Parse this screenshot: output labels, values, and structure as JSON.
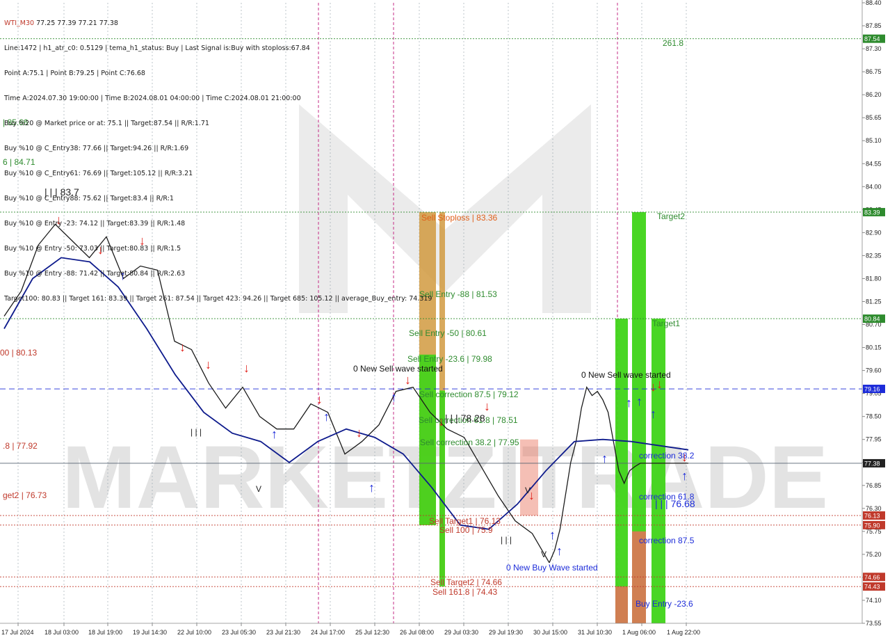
{
  "header": {
    "symbol": "WTI_M30",
    "ohlc": "77.25 77.39 77.21 77.38"
  },
  "info_lines": [
    "Line:1472 | h1_atr_c0: 0.5129 | tema_h1_status: Buy | Last Signal is:Buy with stoploss:67.84",
    "Point A:75.1 | Point B:79.25 | Point C:76.68",
    "Time A:2024.07.30 19:00:00 | Time B:2024.08.01 04:00:00 | Time C:2024.08.01 21:00:00",
    "Buy %20 @ Market price or at: 75.1 || Target:87.54 || R/R:1.71",
    "Buy %10 @ C_Entry38: 77.66 || Target:94.26 || R/R:1.69",
    "Buy %10 @ C_Entry61: 76.69 || Target:105.12 || R/R:3.21",
    "Buy %10 @ C_Entry88: 75.62 || Target:83.4 || R/R:1",
    "Buy %10 @ Entry -23: 74.12 || Target:83.39 || R/R:1.48",
    "Buy %10 @ Entry -50: 73.03 || Target:80.83 || R/R:1.5",
    "Buy %10 @ Entry -88: 71.42 || Target:80.84 || R/R:2.63",
    "Target100: 80.83 || Target 161: 83.39 || Target 261: 87.54 || Target 423: 94.26 || Target 685: 105.12 || average_Buy_entry: 74.319"
  ],
  "watermark": "MARKETZITRADE",
  "chart_data": {
    "type": "line",
    "title": "",
    "xlabel": "",
    "ylabel": "",
    "ylim": [
      73.55,
      88.4
    ],
    "y_ticks": [
      "88.40",
      "87.85",
      "87.30",
      "86.75",
      "86.20",
      "85.65",
      "85.10",
      "84.55",
      "84.00",
      "83.45",
      "82.90",
      "82.35",
      "81.80",
      "81.25",
      "80.70",
      "80.15",
      "79.60",
      "79.05",
      "78.50",
      "77.95",
      "77.40",
      "76.85",
      "76.30",
      "75.75",
      "75.20",
      "74.65",
      "74.10",
      "73.55"
    ],
    "x_ticks": [
      "17 Jul 2024",
      "18 Jul 03:00",
      "18 Jul 19:00",
      "19 Jul 14:30",
      "22 Jul 10:00",
      "23 Jul 05:30",
      "23 Jul 21:30",
      "24 Jul 17:00",
      "25 Jul 12:30",
      "26 Jul 08:00",
      "29 Jul 03:30",
      "29 Jul 19:30",
      "30 Jul 15:00",
      "31 Jul 10:30",
      "1 Aug 06:00",
      "1 Aug 22:00"
    ],
    "price_series": {
      "name": "",
      "x": [
        0,
        0.5,
        1,
        1.5,
        2,
        2.5,
        3,
        3.5,
        4,
        4.5,
        5,
        5.5,
        6,
        6.5,
        7,
        7.5,
        8,
        8.5,
        9,
        9.5,
        10,
        10.5,
        11,
        11.5,
        12,
        12.5,
        13,
        13.5,
        14,
        14.5,
        15,
        15.5,
        16
      ],
      "y": [
        80.9,
        81.5,
        82.6,
        83.1,
        82.7,
        82.3,
        82.8,
        81.8,
        82.1,
        82.0,
        80.3,
        80.1,
        79.3,
        78.7,
        79.2,
        78.5,
        78.2,
        78.2,
        78.8,
        78.6,
        77.6,
        77.9,
        78.3,
        79.1,
        79.2,
        78.6,
        78.2,
        78.0,
        77.3,
        76.6,
        76.0,
        75.7,
        75.0
      ]
    },
    "price_series_2": {
      "name": "",
      "x": [
        16,
        16.5,
        17,
        17.5,
        18,
        18.5,
        19,
        19.5,
        20,
        20.5,
        21,
        21.5,
        22,
        22.5,
        23,
        23.5,
        24,
        24.5,
        25,
        25.5,
        26,
        26.5,
        27,
        27.5,
        28,
        28.5,
        29
      ],
      "y": [
        75.0,
        75.3,
        75.8,
        76.6,
        77.4,
        77.9,
        78.7,
        79.2,
        79.0,
        79.1,
        78.9,
        78.6,
        77.9,
        77.2,
        76.9,
        77.2,
        77.3,
        77.38,
        77.38,
        77.38,
        77.38,
        77.38,
        77.38,
        77.38,
        77.38,
        77.38,
        77.38
      ]
    },
    "ma_series": {
      "name": "",
      "x": [
        0,
        1,
        2,
        3,
        4,
        5,
        6,
        7,
        8,
        9,
        10,
        11,
        12,
        13,
        14,
        15,
        16,
        17,
        18,
        19,
        20,
        21,
        22,
        23,
        24
      ],
      "y": [
        80.6,
        81.8,
        82.3,
        82.2,
        81.6,
        80.6,
        79.5,
        78.6,
        78.1,
        77.9,
        77.4,
        77.9,
        78.2,
        78.0,
        77.6,
        76.8,
        75.9,
        75.8,
        76.4,
        77.2,
        77.9,
        77.95,
        77.9,
        77.8,
        77.7
      ]
    },
    "h_levels": [
      {
        "name": "87.54",
        "y": 87.54,
        "color": "#2e8b2e",
        "style": "dotted"
      },
      {
        "name": "83.39",
        "y": 83.39,
        "color": "#2e8b2e",
        "style": "dotted"
      },
      {
        "name": "80.84",
        "y": 80.84,
        "color": "#2e8b2e",
        "style": "dotted"
      },
      {
        "name": "79.16",
        "y": 79.16,
        "color": "#1c2bd9",
        "style": "dashed"
      },
      {
        "name": "77.38",
        "y": 77.38,
        "color": "#556070",
        "style": "solid"
      },
      {
        "name": "76.13",
        "y": 76.13,
        "color": "#c0392b",
        "style": "dotted"
      },
      {
        "name": "75.90",
        "y": 75.9,
        "color": "#c0392b",
        "style": "dotted"
      },
      {
        "name": "74.66",
        "y": 74.66,
        "color": "#c0392b",
        "style": "dotted"
      },
      {
        "name": "74.43",
        "y": 74.43,
        "color": "#c0392b",
        "style": "dotted"
      }
    ],
    "price_badges": [
      {
        "text": "87.54",
        "y": 87.54,
        "color": "#2e8b2e"
      },
      {
        "text": "83.39",
        "y": 83.39,
        "color": "#2e8b2e"
      },
      {
        "text": "80.84",
        "y": 80.84,
        "color": "#2e8b2e"
      },
      {
        "text": "79.16",
        "y": 79.16,
        "color": "#1c2bd9"
      },
      {
        "text": "77.38",
        "y": 77.38,
        "color": "#222222"
      },
      {
        "text": "76.13",
        "y": 76.13,
        "color": "#c0392b"
      },
      {
        "text": "75.90",
        "y": 75.9,
        "color": "#c0392b"
      },
      {
        "text": "74.66",
        "y": 74.66,
        "color": "#c0392b"
      },
      {
        "text": "74.43",
        "y": 74.43,
        "color": "#c0392b"
      }
    ],
    "annotations": [
      {
        "text": "261.8",
        "color": "#2e8b2e"
      },
      {
        "text": "| 85.66",
        "color": "#2e8b2e"
      },
      {
        "text": "6 | 84.71",
        "color": "#2e8b2e"
      },
      {
        "text": "| | | 83.7",
        "color": "#222222"
      },
      {
        "text": "Sell Stoploss | 83.36",
        "color": "#e0601a"
      },
      {
        "text": "Target2",
        "color": "#2e8b2e"
      },
      {
        "text": "Sell Entry -88 | 81.53",
        "color": "#2e8b2e"
      },
      {
        "text": "Sell Entry -50 | 80.61",
        "color": "#2e8b2e"
      },
      {
        "text": "Target1",
        "color": "#2e8b2e"
      },
      {
        "text": "00 | 80.13",
        "color": "#c0392b"
      },
      {
        "text": "Sell Entry -23.6 | 79.98",
        "color": "#2e8b2e"
      },
      {
        "text": "0 New Sell wave started",
        "color": "#111111"
      },
      {
        "text": "0 New Sell wave started",
        "color": "#111111"
      },
      {
        "text": "Sell correction 87.5 | 79.12",
        "color": "#2e8b2e"
      },
      {
        "text": "Sell correction 61.8 | 78.51",
        "color": "#2e8b2e"
      },
      {
        "text": "| | | 78.28",
        "color": "#222222"
      },
      {
        "text": "Sell correction 38.2 | 77.95",
        "color": "#2e8b2e"
      },
      {
        "text": ".8 | 77.92",
        "color": "#c0392b"
      },
      {
        "text": "correction 38.2",
        "color": "#1c2bd9"
      },
      {
        "text": "get2 | 76.73",
        "color": "#c0392b"
      },
      {
        "text": "correction 61.8",
        "color": "#1c2bd9"
      },
      {
        "text": "| | | 76.68",
        "color": "#1c2bd9"
      },
      {
        "text": "Sell Target1 | 76.13",
        "color": "#c0392b"
      },
      {
        "text": "Sell 100 | 75.9",
        "color": "#c0392b"
      },
      {
        "text": "correction 87.5",
        "color": "#1c2bd9"
      },
      {
        "text": "0 New Buy Wave started",
        "color": "#1c2bd9"
      },
      {
        "text": "Sell Target2 | 74.66",
        "color": "#c0392b"
      },
      {
        "text": "Sell 161.8 | 74.43",
        "color": "#c0392b"
      },
      {
        "text": "Buy Entry -23.6",
        "color": "#1c2bd9"
      },
      {
        "text": "| | |",
        "color": "#222222"
      },
      {
        "text": "| | |",
        "color": "#222222"
      },
      {
        "text": "V",
        "color": "#222222"
      },
      {
        "text": "V",
        "color": "#222222"
      },
      {
        "text": "V",
        "color": "#222222"
      }
    ],
    "colors": {
      "bull": "#1a1a1a",
      "ma": "#0d1a8c",
      "envelope": "#e0601a",
      "green_zone": "#3fd418",
      "orange_zone": "#d19a3f",
      "red_zone": "#e8705a",
      "magenta_line": "#c0187a",
      "grid": "#8fa0a8"
    },
    "grid": true
  }
}
